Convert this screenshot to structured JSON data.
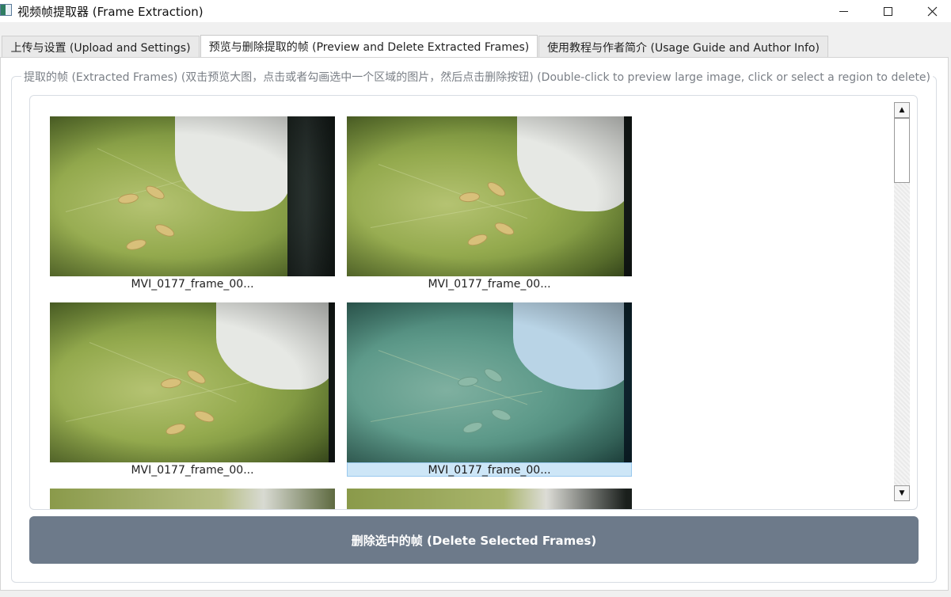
{
  "window": {
    "title": "视频帧提取器 (Frame Extraction)",
    "icon": "app-icon",
    "controls": [
      "minimize-icon",
      "maximize-icon",
      "close-icon"
    ]
  },
  "tabs": [
    {
      "label": "上传与设置 (Upload and Settings)",
      "active": false
    },
    {
      "label": "预览与删除提取的帧 (Preview and Delete Extracted Frames)",
      "active": true
    },
    {
      "label": "使用教程与作者简介 (Usage Guide and Author Info)",
      "active": false
    }
  ],
  "group": {
    "title": "提取的帧 (Extracted Frames) (双击预览大图，点击或者勾画选中一个区域的图片，然后点击删除按钮) (Double-click to preview large image, click or select a region to delete)"
  },
  "frames": [
    {
      "caption": "MVI_0177_frame_00...",
      "selected": false
    },
    {
      "caption": "MVI_0177_frame_00...",
      "selected": false
    },
    {
      "caption": "MVI_0177_frame_00...",
      "selected": false
    },
    {
      "caption": "MVI_0177_frame_00...",
      "selected": true
    }
  ],
  "scrollbar": {
    "up_icon": "▲",
    "down_icon": "▼"
  },
  "delete_button": {
    "label": "删除选中的帧 (Delete Selected Frames)"
  },
  "colors": {
    "delete_button_bg": "#6d7a8a",
    "selection_highlight": "#cde6f7",
    "pane_bg": "#ffffff"
  }
}
